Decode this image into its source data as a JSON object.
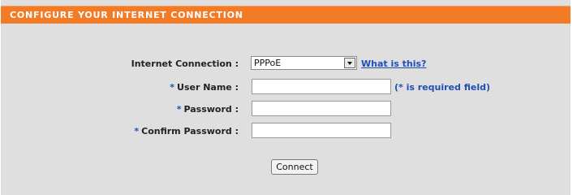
{
  "section": {
    "title": "CONFIGURE YOUR INTERNET CONNECTION"
  },
  "form": {
    "connection_label": "Internet Connection :",
    "connection_value": "PPPoE",
    "help_link": "What is this?",
    "required_marker": "*",
    "username_label": "User Name :",
    "password_label": "Password :",
    "confirm_label": "Confirm Password :",
    "required_hint": "(* is required field)",
    "username_value": "",
    "password_value": "",
    "confirm_value": ""
  },
  "actions": {
    "connect_label": "Connect"
  },
  "colors": {
    "header_bg": "#f47b25",
    "panel_bg": "#dfdfdf",
    "link": "#1e4fb8"
  }
}
